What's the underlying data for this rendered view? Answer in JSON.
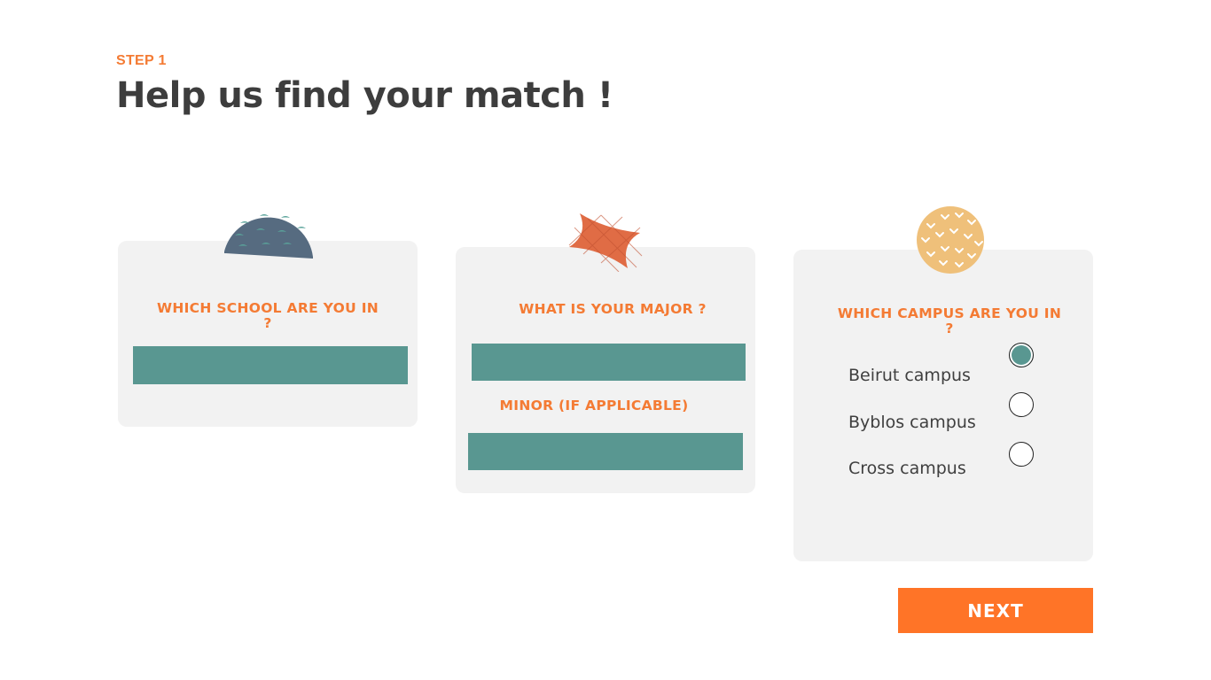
{
  "header": {
    "step_label": "STEP 1",
    "title": "Help us find your match !"
  },
  "school_card": {
    "question": "WHICH SCHOOL ARE YOU IN ?",
    "input_value": ""
  },
  "major_card": {
    "question": "WHAT IS YOUR MAJOR ?",
    "major_value": "",
    "minor_label": "MINOR (IF APPLICABLE)",
    "minor_value": ""
  },
  "campus_card": {
    "question": "WHICH CAMPUS ARE YOU IN ?",
    "options": [
      {
        "label": "Beirut campus",
        "selected": true
      },
      {
        "label": "Byblos campus",
        "selected": false
      },
      {
        "label": "Cross campus",
        "selected": false
      }
    ]
  },
  "next_button": {
    "label": "NEXT"
  },
  "colors": {
    "accent_orange": "#f47b34",
    "button_orange": "#ff7427",
    "field_teal": "#599791",
    "card_gray": "#f2f2f2",
    "title_dark": "#3d3d3d"
  },
  "decorations": [
    "semicircle-patterned-icon",
    "star-sticker-icon",
    "dotted-circle-icon"
  ]
}
